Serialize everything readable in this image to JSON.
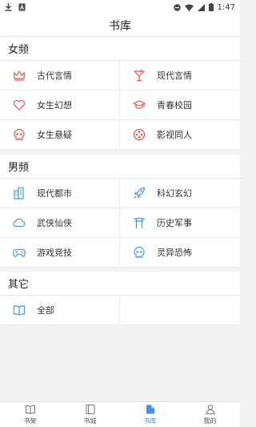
{
  "status_bar": {
    "time": "1:47",
    "icons": [
      "download-icon",
      "notification-a-icon",
      "do-not-disturb-icon",
      "wifi-icon",
      "signal-icon",
      "battery-icon"
    ]
  },
  "header": {
    "title": "书库"
  },
  "sections": [
    {
      "title": "女频",
      "items": [
        {
          "label": "古代言情",
          "icon": "crown-icon"
        },
        {
          "label": "现代言情",
          "icon": "cocktail-icon"
        },
        {
          "label": "女生幻想",
          "icon": "heart-icon"
        },
        {
          "label": "青春校园",
          "icon": "graduation-cap-icon"
        },
        {
          "label": "女生悬疑",
          "icon": "skull-icon"
        },
        {
          "label": "影视同人",
          "icon": "film-reel-icon"
        }
      ]
    },
    {
      "title": "男频",
      "items": [
        {
          "label": "现代都市",
          "icon": "city-buildings-icon"
        },
        {
          "label": "科幻玄幻",
          "icon": "rocket-icon"
        },
        {
          "label": "武侠仙侠",
          "icon": "cloud-icon"
        },
        {
          "label": "历史军事",
          "icon": "gate-icon"
        },
        {
          "label": "游戏竞技",
          "icon": "gamepad-icon"
        },
        {
          "label": "灵异恐怖",
          "icon": "ghost-skull-icon"
        }
      ]
    },
    {
      "title": "其它",
      "items": [
        {
          "label": "全部",
          "icon": "open-book-icon"
        }
      ]
    }
  ],
  "tab_bar": {
    "tabs": [
      {
        "label": "书架",
        "icon": "bookshelf-icon",
        "active": false
      },
      {
        "label": "书城",
        "icon": "bookstore-icon",
        "active": false
      },
      {
        "label": "书库",
        "icon": "library-icon",
        "active": true
      },
      {
        "label": "我的",
        "icon": "profile-icon",
        "active": false
      }
    ]
  },
  "colors": {
    "female_accent": "#e0584f",
    "male_accent": "#4a9ad6",
    "tab_active": "#4a90e2"
  }
}
